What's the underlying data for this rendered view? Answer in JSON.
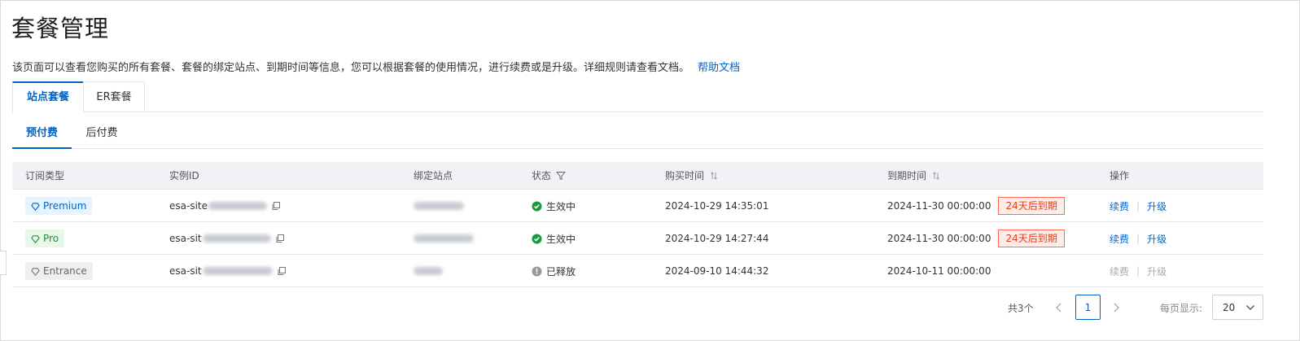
{
  "page": {
    "title": "套餐管理",
    "description": "该页面可以查看您购买的所有套餐、套餐的绑定站点、到期时间等信息，您可以根据套餐的使用情况，进行续费或是升级。详细规则请查看文档。",
    "help_link": "帮助文档"
  },
  "tabs": [
    {
      "label": "站点套餐",
      "active": true
    },
    {
      "label": "ER套餐",
      "active": false
    }
  ],
  "subtabs": [
    {
      "label": "预付费",
      "active": true
    },
    {
      "label": "后付费",
      "active": false
    }
  ],
  "table": {
    "headers": {
      "type": "订阅类型",
      "instance": "实例ID",
      "site": "绑定站点",
      "status": "状态",
      "purchase_time": "购买时间",
      "expire_time": "到期时间",
      "actions": "操作"
    },
    "rows": [
      {
        "type": "Premium",
        "type_style": "premium",
        "instance_prefix": "esa-site",
        "status": "生效中",
        "status_kind": "active",
        "purchase_time": "2024-10-29 14:35:01",
        "expire_time": "2024-11-30 00:00:00",
        "expire_tag": "24天后到期",
        "renew": "续费",
        "upgrade": "升级",
        "actions_enabled": true
      },
      {
        "type": "Pro",
        "type_style": "pro",
        "instance_prefix": "esa-sit",
        "status": "生效中",
        "status_kind": "active",
        "purchase_time": "2024-10-29 14:27:44",
        "expire_time": "2024-11-30 00:00:00",
        "expire_tag": "24天后到期",
        "renew": "续费",
        "upgrade": "升级",
        "actions_enabled": true
      },
      {
        "type": "Entrance",
        "type_style": "entrance",
        "instance_prefix": "esa-sit",
        "status": "已释放",
        "status_kind": "released",
        "purchase_time": "2024-09-10 14:44:32",
        "expire_time": "2024-10-11 00:00:00",
        "expire_tag": "",
        "renew": "续费",
        "upgrade": "升级",
        "actions_enabled": false
      }
    ]
  },
  "pagination": {
    "total": "共3个",
    "current_page": "1",
    "page_size_label": "每页显示:",
    "page_size": "20"
  },
  "colors": {
    "primary": "#0064c8",
    "success": "#1a9c3e",
    "danger": "#e03e1a",
    "muted": "#999999"
  },
  "icons": {
    "type_badge": "diamond-icon",
    "copy": "copy-icon",
    "filter": "filter-icon",
    "sort": "sort-icon",
    "active": "check-circle-icon",
    "released": "exclamation-circle-icon",
    "prev": "chevron-left-icon",
    "next": "chevron-right-icon",
    "dropdown": "chevron-down-icon"
  }
}
